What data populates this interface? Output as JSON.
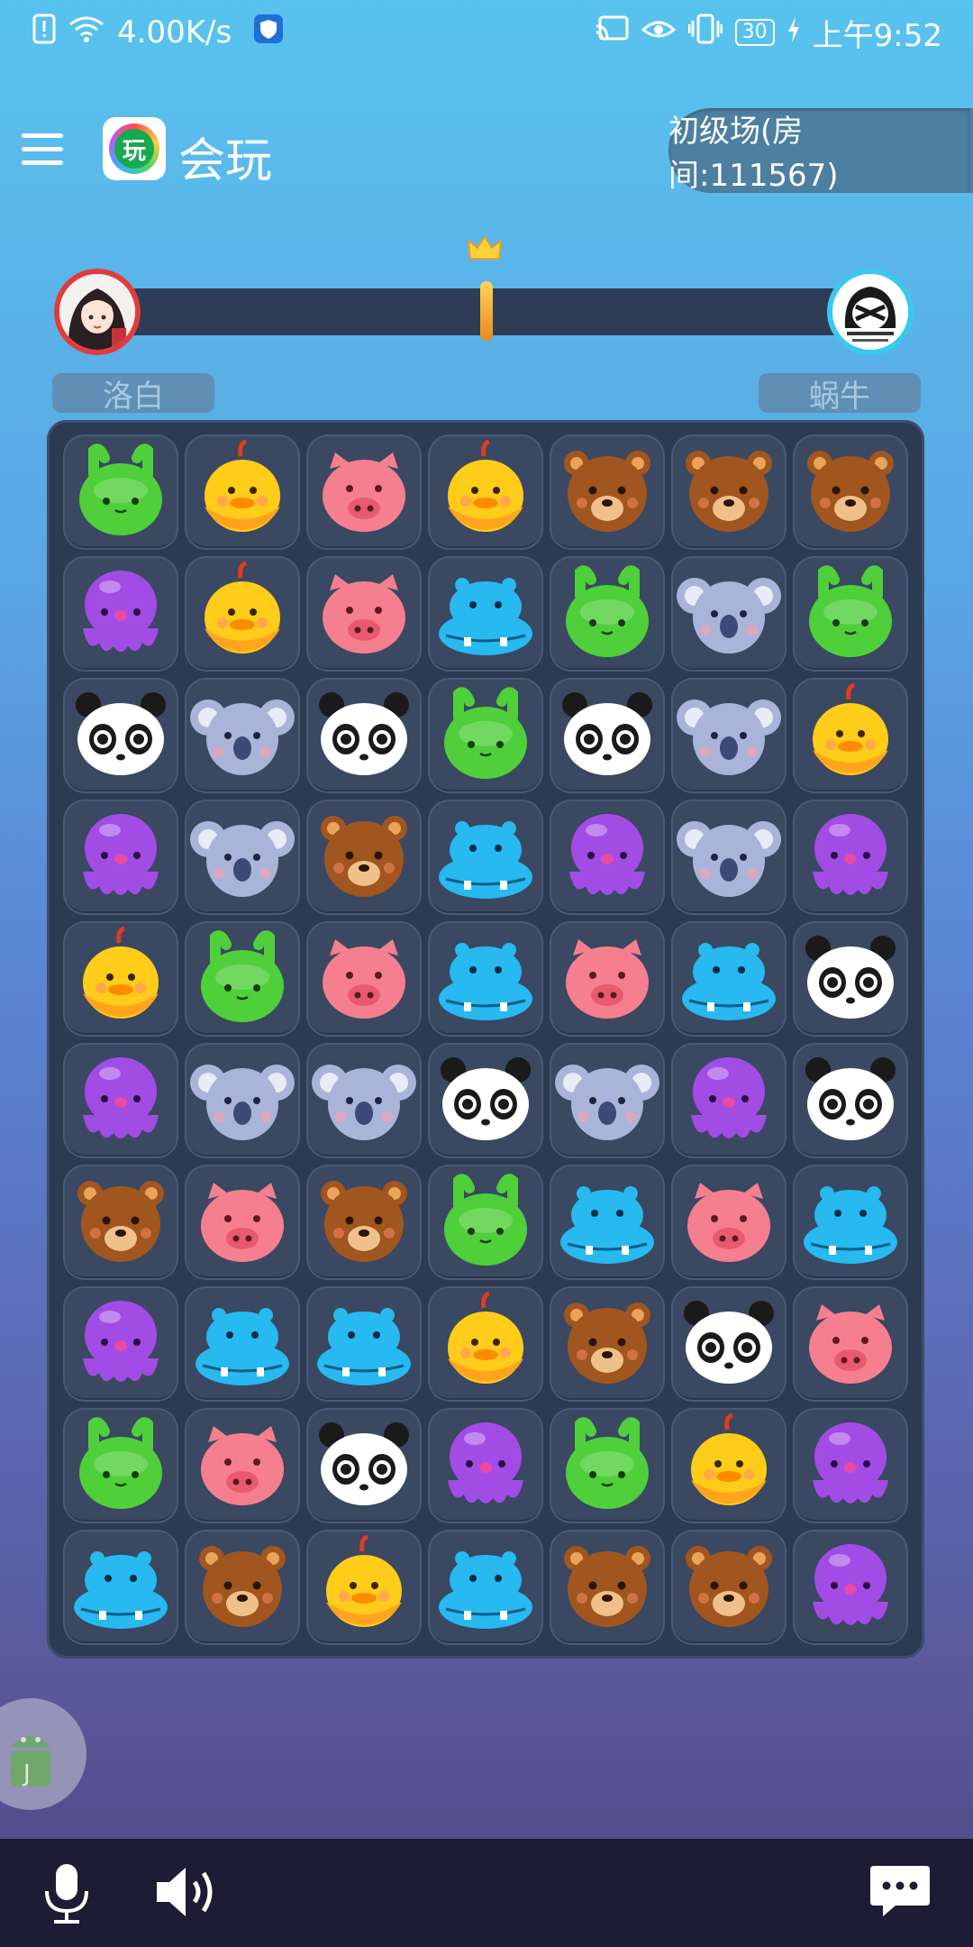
{
  "status_bar": {
    "network_speed": "4.00K/s",
    "battery": "30",
    "time": "上午9:52"
  },
  "header": {
    "app_name": "会玩",
    "logo_char": "玩",
    "room": "初级场(房间:111567)"
  },
  "players": {
    "left": "洛白",
    "right": "蜗牛"
  },
  "progress": {
    "marker_fraction": 0.5
  },
  "board": {
    "rows": 10,
    "cols": 7,
    "grid": [
      [
        "frog",
        "chick",
        "pig",
        "chick",
        "bear",
        "bear",
        "bear"
      ],
      [
        "octopus",
        "chick",
        "pig",
        "hippo",
        "frog",
        "koala",
        "frog"
      ],
      [
        "panda",
        "koala",
        "panda",
        "frog",
        "panda",
        "koala",
        "chick"
      ],
      [
        "octopus",
        "koala",
        "bear",
        "hippo",
        "octopus",
        "koala",
        "octopus"
      ],
      [
        "chick",
        "frog",
        "pig",
        "hippo",
        "pig",
        "hippo",
        "panda"
      ],
      [
        "octopus",
        "koala",
        "koala",
        "panda",
        "koala",
        "octopus",
        "panda"
      ],
      [
        "bear",
        "pig",
        "bear",
        "frog",
        "hippo",
        "pig",
        "hippo"
      ],
      [
        "octopus",
        "hippo",
        "hippo",
        "chick",
        "bear",
        "panda",
        "pig"
      ],
      [
        "frog",
        "pig",
        "panda",
        "octopus",
        "frog",
        "chick",
        "octopus"
      ],
      [
        "hippo",
        "bear",
        "chick",
        "hippo",
        "bear",
        "bear",
        "octopus"
      ]
    ],
    "colors": {
      "frog": "#4fcf3a",
      "chick": "#ffcc1a",
      "pig": "#f57f8e",
      "bear": "#a0561e",
      "octopus": "#a24ce6",
      "hippo": "#27b9ef",
      "koala": "#aab4d8",
      "panda": "#ffffff"
    }
  }
}
